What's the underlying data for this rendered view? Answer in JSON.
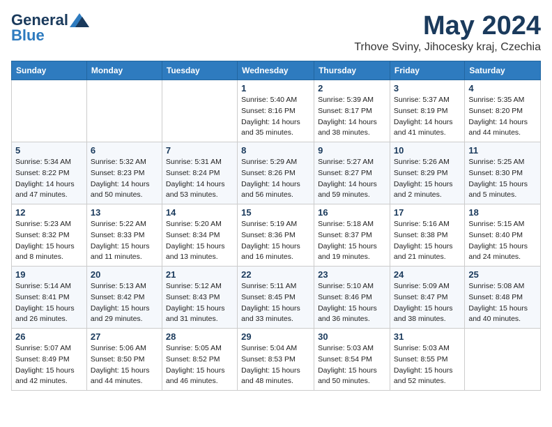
{
  "logo": {
    "general": "General",
    "blue": "Blue"
  },
  "title": {
    "month": "May 2024",
    "location": "Trhove Sviny, Jihocesky kraj, Czechia"
  },
  "weekdays": [
    "Sunday",
    "Monday",
    "Tuesday",
    "Wednesday",
    "Thursday",
    "Friday",
    "Saturday"
  ],
  "weeks": [
    [
      {
        "day": "",
        "info": ""
      },
      {
        "day": "",
        "info": ""
      },
      {
        "day": "",
        "info": ""
      },
      {
        "day": "1",
        "info": "Sunrise: 5:40 AM\nSunset: 8:16 PM\nDaylight: 14 hours and 35 minutes."
      },
      {
        "day": "2",
        "info": "Sunrise: 5:39 AM\nSunset: 8:17 PM\nDaylight: 14 hours and 38 minutes."
      },
      {
        "day": "3",
        "info": "Sunrise: 5:37 AM\nSunset: 8:19 PM\nDaylight: 14 hours and 41 minutes."
      },
      {
        "day": "4",
        "info": "Sunrise: 5:35 AM\nSunset: 8:20 PM\nDaylight: 14 hours and 44 minutes."
      }
    ],
    [
      {
        "day": "5",
        "info": "Sunrise: 5:34 AM\nSunset: 8:22 PM\nDaylight: 14 hours and 47 minutes."
      },
      {
        "day": "6",
        "info": "Sunrise: 5:32 AM\nSunset: 8:23 PM\nDaylight: 14 hours and 50 minutes."
      },
      {
        "day": "7",
        "info": "Sunrise: 5:31 AM\nSunset: 8:24 PM\nDaylight: 14 hours and 53 minutes."
      },
      {
        "day": "8",
        "info": "Sunrise: 5:29 AM\nSunset: 8:26 PM\nDaylight: 14 hours and 56 minutes."
      },
      {
        "day": "9",
        "info": "Sunrise: 5:27 AM\nSunset: 8:27 PM\nDaylight: 14 hours and 59 minutes."
      },
      {
        "day": "10",
        "info": "Sunrise: 5:26 AM\nSunset: 8:29 PM\nDaylight: 15 hours and 2 minutes."
      },
      {
        "day": "11",
        "info": "Sunrise: 5:25 AM\nSunset: 8:30 PM\nDaylight: 15 hours and 5 minutes."
      }
    ],
    [
      {
        "day": "12",
        "info": "Sunrise: 5:23 AM\nSunset: 8:32 PM\nDaylight: 15 hours and 8 minutes."
      },
      {
        "day": "13",
        "info": "Sunrise: 5:22 AM\nSunset: 8:33 PM\nDaylight: 15 hours and 11 minutes."
      },
      {
        "day": "14",
        "info": "Sunrise: 5:20 AM\nSunset: 8:34 PM\nDaylight: 15 hours and 13 minutes."
      },
      {
        "day": "15",
        "info": "Sunrise: 5:19 AM\nSunset: 8:36 PM\nDaylight: 15 hours and 16 minutes."
      },
      {
        "day": "16",
        "info": "Sunrise: 5:18 AM\nSunset: 8:37 PM\nDaylight: 15 hours and 19 minutes."
      },
      {
        "day": "17",
        "info": "Sunrise: 5:16 AM\nSunset: 8:38 PM\nDaylight: 15 hours and 21 minutes."
      },
      {
        "day": "18",
        "info": "Sunrise: 5:15 AM\nSunset: 8:40 PM\nDaylight: 15 hours and 24 minutes."
      }
    ],
    [
      {
        "day": "19",
        "info": "Sunrise: 5:14 AM\nSunset: 8:41 PM\nDaylight: 15 hours and 26 minutes."
      },
      {
        "day": "20",
        "info": "Sunrise: 5:13 AM\nSunset: 8:42 PM\nDaylight: 15 hours and 29 minutes."
      },
      {
        "day": "21",
        "info": "Sunrise: 5:12 AM\nSunset: 8:43 PM\nDaylight: 15 hours and 31 minutes."
      },
      {
        "day": "22",
        "info": "Sunrise: 5:11 AM\nSunset: 8:45 PM\nDaylight: 15 hours and 33 minutes."
      },
      {
        "day": "23",
        "info": "Sunrise: 5:10 AM\nSunset: 8:46 PM\nDaylight: 15 hours and 36 minutes."
      },
      {
        "day": "24",
        "info": "Sunrise: 5:09 AM\nSunset: 8:47 PM\nDaylight: 15 hours and 38 minutes."
      },
      {
        "day": "25",
        "info": "Sunrise: 5:08 AM\nSunset: 8:48 PM\nDaylight: 15 hours and 40 minutes."
      }
    ],
    [
      {
        "day": "26",
        "info": "Sunrise: 5:07 AM\nSunset: 8:49 PM\nDaylight: 15 hours and 42 minutes."
      },
      {
        "day": "27",
        "info": "Sunrise: 5:06 AM\nSunset: 8:50 PM\nDaylight: 15 hours and 44 minutes."
      },
      {
        "day": "28",
        "info": "Sunrise: 5:05 AM\nSunset: 8:52 PM\nDaylight: 15 hours and 46 minutes."
      },
      {
        "day": "29",
        "info": "Sunrise: 5:04 AM\nSunset: 8:53 PM\nDaylight: 15 hours and 48 minutes."
      },
      {
        "day": "30",
        "info": "Sunrise: 5:03 AM\nSunset: 8:54 PM\nDaylight: 15 hours and 50 minutes."
      },
      {
        "day": "31",
        "info": "Sunrise: 5:03 AM\nSunset: 8:55 PM\nDaylight: 15 hours and 52 minutes."
      },
      {
        "day": "",
        "info": ""
      }
    ]
  ]
}
